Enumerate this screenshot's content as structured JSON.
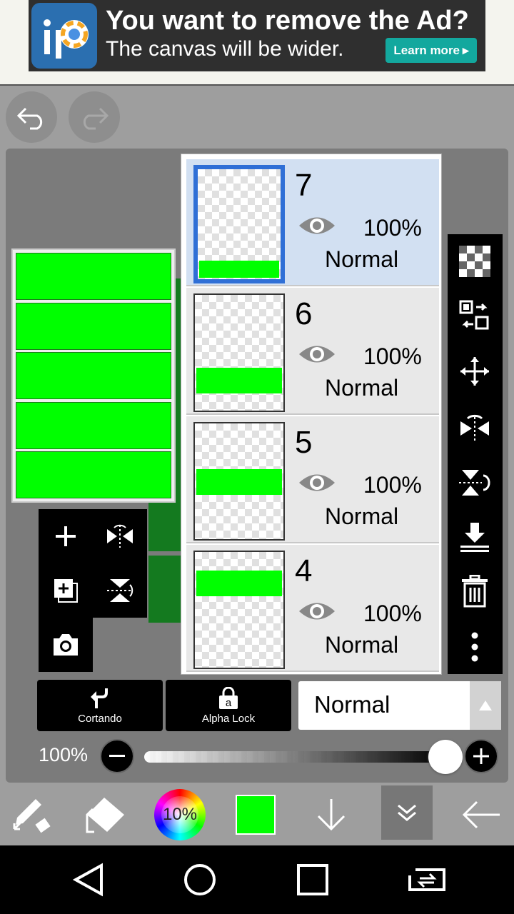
{
  "ad": {
    "title": "You want to remove the Ad?",
    "subtitle": "The canvas will be wider.",
    "learn_more": "Learn more"
  },
  "layers": [
    {
      "name": "7",
      "opacity": "100%",
      "mode": "Normal",
      "selected": true
    },
    {
      "name": "6",
      "opacity": "100%",
      "mode": "Normal",
      "selected": false
    },
    {
      "name": "5",
      "opacity": "100%",
      "mode": "Normal",
      "selected": false
    },
    {
      "name": "4",
      "opacity": "100%",
      "mode": "Normal",
      "selected": false
    }
  ],
  "buttons": {
    "clipping": "Cortando",
    "alpha_lock": "Alpha Lock"
  },
  "blend_mode": "Normal",
  "opacity": {
    "label": "100%",
    "value": 1.0
  },
  "brush_size": "10%",
  "colors": {
    "primary": "#00ff00",
    "selection": "#2f6fd6"
  }
}
